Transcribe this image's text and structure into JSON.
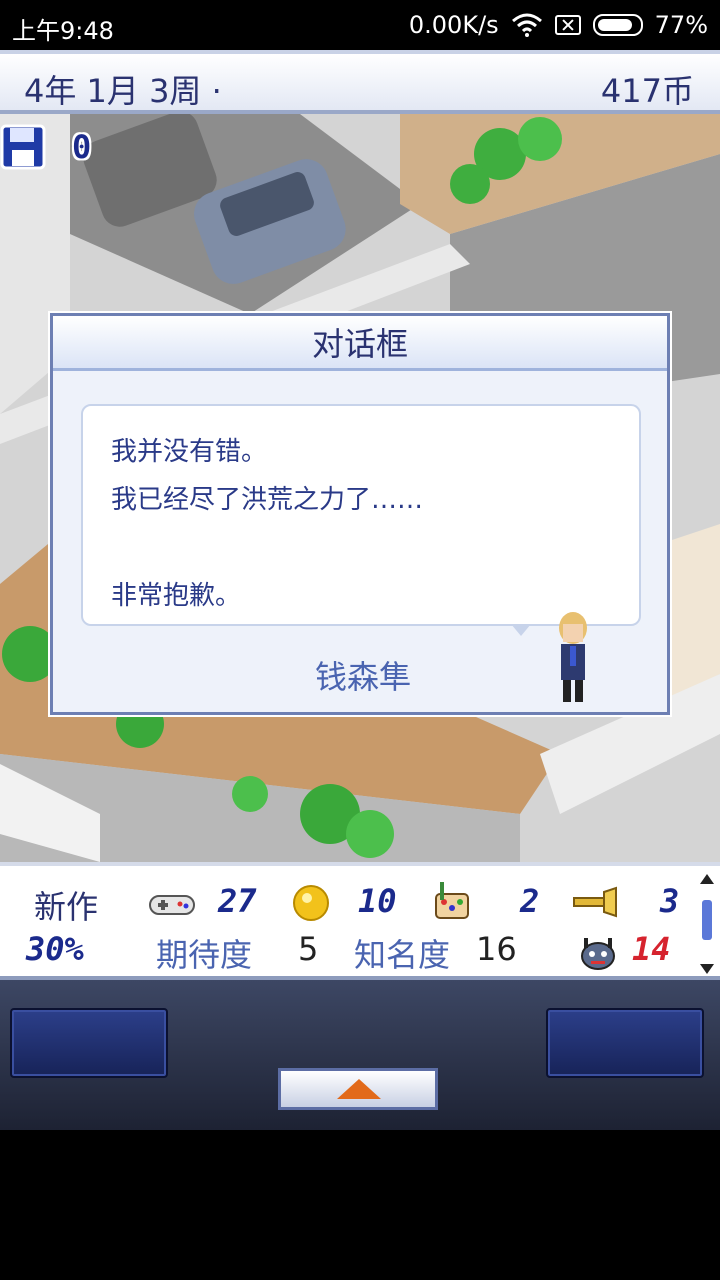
{
  "status_bar": {
    "time": "上午9:48",
    "network_speed": "0.00K/s",
    "battery": "77%"
  },
  "header": {
    "date": "4年 1月 3周 ·",
    "money": "417币"
  },
  "save": {
    "count": "0"
  },
  "dialog": {
    "title": "对话框",
    "lines": [
      "我并没有错。",
      "我已经尽了洪荒之力了……",
      "",
      "非常抱歉。"
    ],
    "speaker": "钱森隼"
  },
  "stats": {
    "new_game_label": "新作",
    "progress": "30%",
    "controller_value": "27",
    "coin_value": "10",
    "paint_value": "2",
    "trumpet_value": "3",
    "expectation_label": "期待度",
    "expectation_value": "5",
    "fame_label": "知名度",
    "fame_value": "16",
    "monster_value": "14"
  },
  "colors": {
    "accent": "#2a3270",
    "bubble_text": "#2a3a88",
    "warning": "#d6232e"
  }
}
